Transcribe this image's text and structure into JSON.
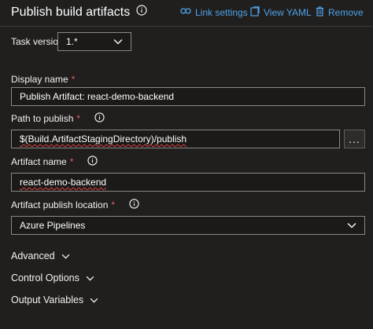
{
  "header": {
    "title": "Publish build artifacts",
    "link_settings": "Link settings",
    "view_yaml": "View YAML",
    "remove": "Remove"
  },
  "task_version": {
    "label": "Task version",
    "value": "1.*"
  },
  "display_name": {
    "label": "Display name",
    "required": "*",
    "value": "Publish Artifact: react-demo-backend"
  },
  "path_to_publish": {
    "label": "Path to publish",
    "required": "*",
    "value": "$(Build.ArtifactStagingDirectory)/publish",
    "browse": "..."
  },
  "artifact_name": {
    "label": "Artifact name",
    "required": "*",
    "value": "react-demo-backend"
  },
  "publish_location": {
    "label": "Artifact publish location",
    "required": "*",
    "value": "Azure Pipelines"
  },
  "sections": {
    "advanced": "Advanced",
    "control_options": "Control Options",
    "output_variables": "Output Variables"
  },
  "colors": {
    "background": "#201f1e",
    "link": "#4fa3e8",
    "required": "#e55c5c",
    "border": "#8a8886"
  },
  "icons": [
    "info-icon",
    "link-icon",
    "view-yaml-icon",
    "trash-icon",
    "chevron-down-icon",
    "ellipsis-icon"
  ]
}
